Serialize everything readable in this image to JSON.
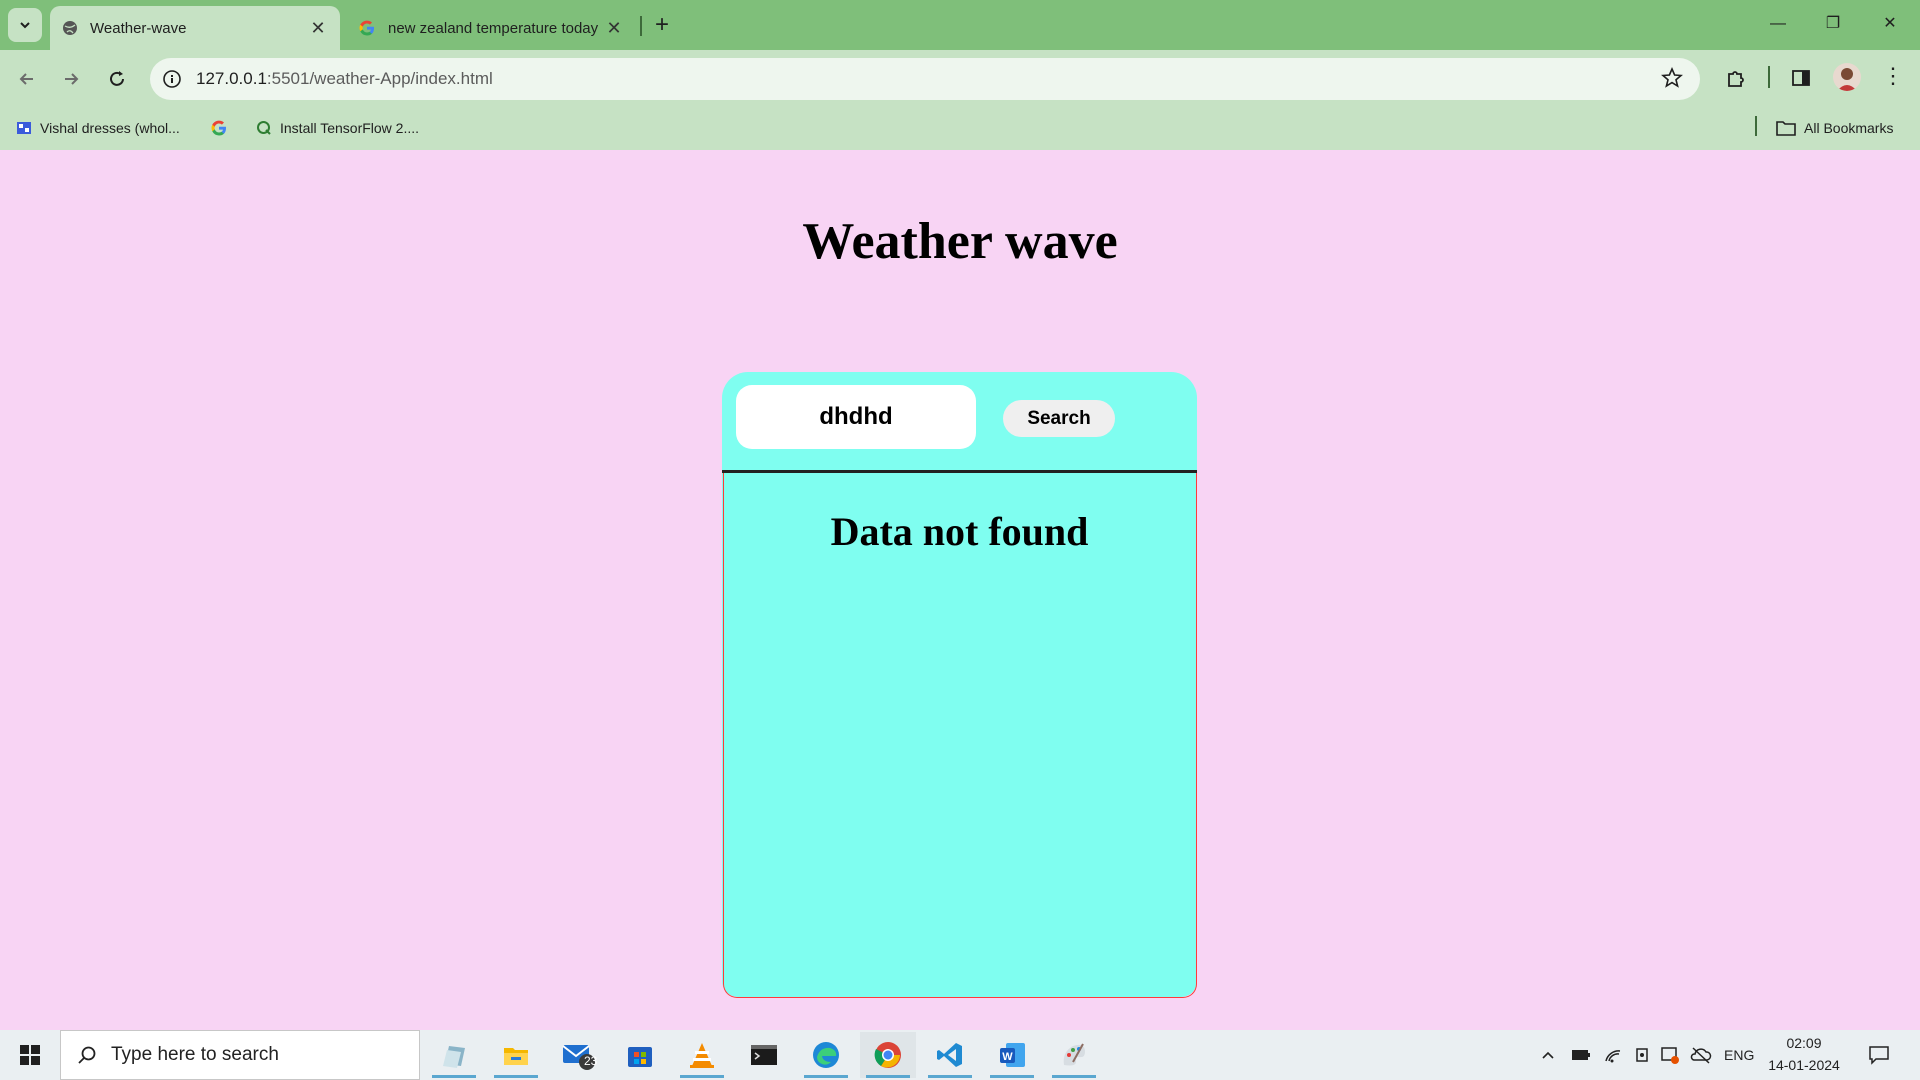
{
  "browser": {
    "tabs": [
      {
        "title": "Weather-wave",
        "icon": "globe-icon",
        "active": true
      },
      {
        "title": "new zealand temperature today",
        "icon": "google-icon",
        "active": false
      }
    ],
    "address_bar": {
      "host": "127.0.0.1",
      "path": ":5501/weather-App/index.html"
    },
    "bookmarks": [
      {
        "label": "Vishal dresses (whol...",
        "icon": "store-icon"
      },
      {
        "label": "",
        "icon": "google-icon"
      },
      {
        "label": "Install TensorFlow 2....",
        "icon": "quora-icon"
      }
    ],
    "all_bookmarks_label": "All Bookmarks"
  },
  "page": {
    "heading": "Weather wave",
    "search": {
      "value": "dhdhd",
      "button_label": "Search"
    },
    "message": "Data not found",
    "colors": {
      "background": "#f8d4f4",
      "card": "#7ffef0"
    }
  },
  "taskbar": {
    "search_placeholder": "Type here to search",
    "apps": [
      "files-icon",
      "file-explorer-icon",
      "mail-icon",
      "store-icon",
      "vlc-icon",
      "terminal-icon",
      "edge-icon",
      "chrome-icon",
      "vscode-icon",
      "word-icon",
      "paint-icon"
    ],
    "mail_badge": "23",
    "language": "ENG",
    "time": "02:09",
    "date": "14-01-2024"
  }
}
